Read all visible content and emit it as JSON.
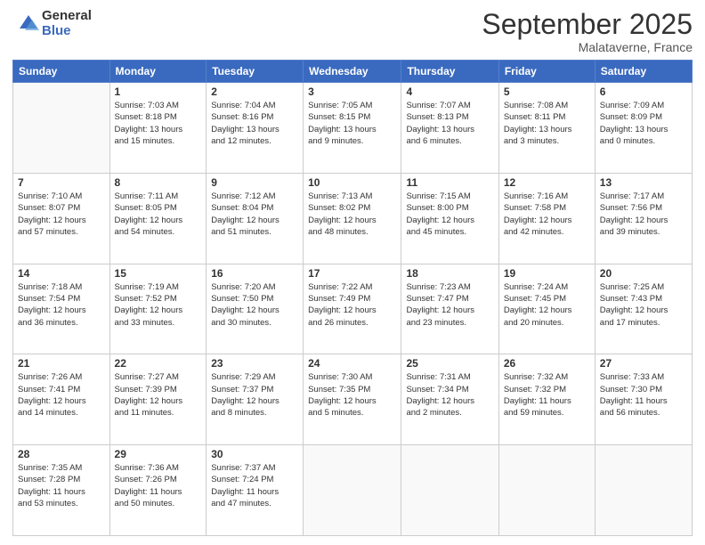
{
  "header": {
    "logo_line1": "General",
    "logo_line2": "Blue",
    "month": "September 2025",
    "location": "Malataverne, France"
  },
  "weekdays": [
    "Sunday",
    "Monday",
    "Tuesday",
    "Wednesday",
    "Thursday",
    "Friday",
    "Saturday"
  ],
  "weeks": [
    [
      {
        "day": "",
        "info": ""
      },
      {
        "day": "1",
        "info": "Sunrise: 7:03 AM\nSunset: 8:18 PM\nDaylight: 13 hours\nand 15 minutes."
      },
      {
        "day": "2",
        "info": "Sunrise: 7:04 AM\nSunset: 8:16 PM\nDaylight: 13 hours\nand 12 minutes."
      },
      {
        "day": "3",
        "info": "Sunrise: 7:05 AM\nSunset: 8:15 PM\nDaylight: 13 hours\nand 9 minutes."
      },
      {
        "day": "4",
        "info": "Sunrise: 7:07 AM\nSunset: 8:13 PM\nDaylight: 13 hours\nand 6 minutes."
      },
      {
        "day": "5",
        "info": "Sunrise: 7:08 AM\nSunset: 8:11 PM\nDaylight: 13 hours\nand 3 minutes."
      },
      {
        "day": "6",
        "info": "Sunrise: 7:09 AM\nSunset: 8:09 PM\nDaylight: 13 hours\nand 0 minutes."
      }
    ],
    [
      {
        "day": "7",
        "info": "Sunrise: 7:10 AM\nSunset: 8:07 PM\nDaylight: 12 hours\nand 57 minutes."
      },
      {
        "day": "8",
        "info": "Sunrise: 7:11 AM\nSunset: 8:05 PM\nDaylight: 12 hours\nand 54 minutes."
      },
      {
        "day": "9",
        "info": "Sunrise: 7:12 AM\nSunset: 8:04 PM\nDaylight: 12 hours\nand 51 minutes."
      },
      {
        "day": "10",
        "info": "Sunrise: 7:13 AM\nSunset: 8:02 PM\nDaylight: 12 hours\nand 48 minutes."
      },
      {
        "day": "11",
        "info": "Sunrise: 7:15 AM\nSunset: 8:00 PM\nDaylight: 12 hours\nand 45 minutes."
      },
      {
        "day": "12",
        "info": "Sunrise: 7:16 AM\nSunset: 7:58 PM\nDaylight: 12 hours\nand 42 minutes."
      },
      {
        "day": "13",
        "info": "Sunrise: 7:17 AM\nSunset: 7:56 PM\nDaylight: 12 hours\nand 39 minutes."
      }
    ],
    [
      {
        "day": "14",
        "info": "Sunrise: 7:18 AM\nSunset: 7:54 PM\nDaylight: 12 hours\nand 36 minutes."
      },
      {
        "day": "15",
        "info": "Sunrise: 7:19 AM\nSunset: 7:52 PM\nDaylight: 12 hours\nand 33 minutes."
      },
      {
        "day": "16",
        "info": "Sunrise: 7:20 AM\nSunset: 7:50 PM\nDaylight: 12 hours\nand 30 minutes."
      },
      {
        "day": "17",
        "info": "Sunrise: 7:22 AM\nSunset: 7:49 PM\nDaylight: 12 hours\nand 26 minutes."
      },
      {
        "day": "18",
        "info": "Sunrise: 7:23 AM\nSunset: 7:47 PM\nDaylight: 12 hours\nand 23 minutes."
      },
      {
        "day": "19",
        "info": "Sunrise: 7:24 AM\nSunset: 7:45 PM\nDaylight: 12 hours\nand 20 minutes."
      },
      {
        "day": "20",
        "info": "Sunrise: 7:25 AM\nSunset: 7:43 PM\nDaylight: 12 hours\nand 17 minutes."
      }
    ],
    [
      {
        "day": "21",
        "info": "Sunrise: 7:26 AM\nSunset: 7:41 PM\nDaylight: 12 hours\nand 14 minutes."
      },
      {
        "day": "22",
        "info": "Sunrise: 7:27 AM\nSunset: 7:39 PM\nDaylight: 12 hours\nand 11 minutes."
      },
      {
        "day": "23",
        "info": "Sunrise: 7:29 AM\nSunset: 7:37 PM\nDaylight: 12 hours\nand 8 minutes."
      },
      {
        "day": "24",
        "info": "Sunrise: 7:30 AM\nSunset: 7:35 PM\nDaylight: 12 hours\nand 5 minutes."
      },
      {
        "day": "25",
        "info": "Sunrise: 7:31 AM\nSunset: 7:34 PM\nDaylight: 12 hours\nand 2 minutes."
      },
      {
        "day": "26",
        "info": "Sunrise: 7:32 AM\nSunset: 7:32 PM\nDaylight: 11 hours\nand 59 minutes."
      },
      {
        "day": "27",
        "info": "Sunrise: 7:33 AM\nSunset: 7:30 PM\nDaylight: 11 hours\nand 56 minutes."
      }
    ],
    [
      {
        "day": "28",
        "info": "Sunrise: 7:35 AM\nSunset: 7:28 PM\nDaylight: 11 hours\nand 53 minutes."
      },
      {
        "day": "29",
        "info": "Sunrise: 7:36 AM\nSunset: 7:26 PM\nDaylight: 11 hours\nand 50 minutes."
      },
      {
        "day": "30",
        "info": "Sunrise: 7:37 AM\nSunset: 7:24 PM\nDaylight: 11 hours\nand 47 minutes."
      },
      {
        "day": "",
        "info": ""
      },
      {
        "day": "",
        "info": ""
      },
      {
        "day": "",
        "info": ""
      },
      {
        "day": "",
        "info": ""
      }
    ]
  ]
}
